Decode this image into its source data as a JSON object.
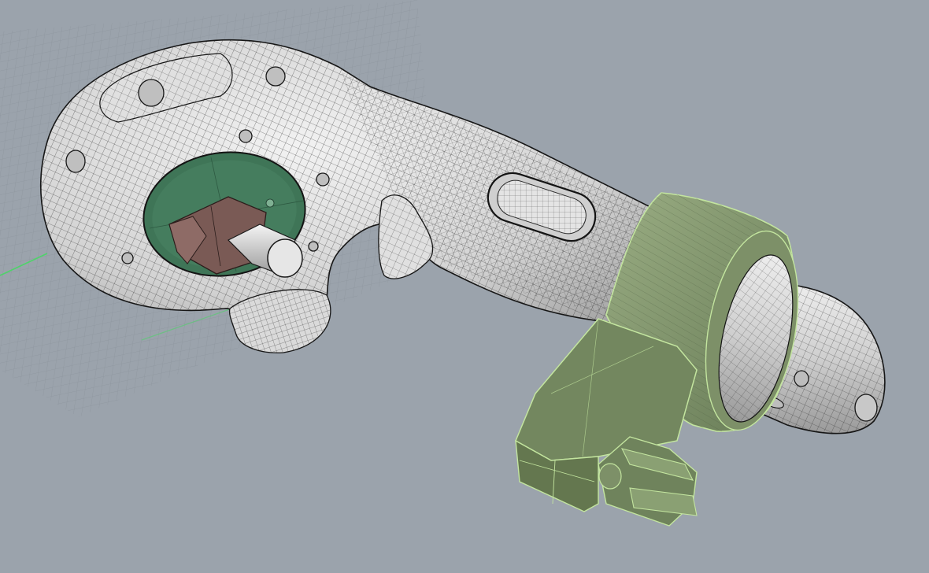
{
  "viewport": {
    "kind": "3d-perspective-viewport",
    "background_color": "#9ba3ac",
    "grid_color": "#8e969f",
    "x_axis_color": "#c0504d",
    "y_axis_color": "#4fd36a",
    "display_mode": "shaded-with-isocurves",
    "model": {
      "body": {
        "name": "handle-body",
        "color": "#d6d6d6",
        "wire_color": "#141414"
      },
      "recess": {
        "name": "circular-recess",
        "color": "#3f7557"
      },
      "component": {
        "name": "motor-component",
        "color": "#7a5a55"
      },
      "shaft": {
        "name": "shaft-cylinder",
        "color": "#e2e2e2"
      },
      "selected_part": {
        "name": "clamp-bracket",
        "color": "#7d9068",
        "edge_color": "#c3e59f"
      },
      "nozzle": {
        "name": "nozzle-tip",
        "color": "#d9d9d9"
      }
    }
  }
}
